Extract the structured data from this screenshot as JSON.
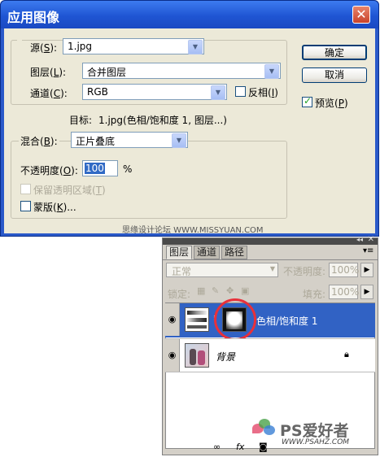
{
  "dialog": {
    "title": "应用图像",
    "close_glyph": "✕",
    "source": {
      "label_pre": "源(",
      "key": "S",
      "label_post": "):",
      "value": "1.jpg"
    },
    "layer": {
      "label_pre": "图层(",
      "key": "L",
      "label_post": "):",
      "value": "合并图层"
    },
    "channel": {
      "label_pre": "通道(",
      "key": "C",
      "label_post": "):",
      "value": "RGB"
    },
    "invert": {
      "label_pre": "反相(",
      "key": "I",
      "label_post": ")",
      "checked": false
    },
    "target": {
      "label": "目标:",
      "value": "1.jpg(色相/饱和度 1, 图层...)"
    },
    "blending": {
      "label_pre": "混合(",
      "key": "B",
      "label_post": "):",
      "value": "正片叠底"
    },
    "opacity": {
      "label_pre": "不透明度(",
      "key": "O",
      "label_post": "):",
      "value": "100",
      "unit": "%"
    },
    "preserve": {
      "label_pre": "保留透明区域(",
      "key": "T",
      "label_post": ")",
      "enabled": false
    },
    "mask": {
      "label_pre": "蒙版(",
      "key": "K",
      "label_post": ")...",
      "checked": false
    },
    "ok_label": "确定",
    "cancel_label": "取消",
    "preview": {
      "label_pre": "预览(",
      "key": "P",
      "label_post": ")",
      "checked": true
    }
  },
  "watermark_top": "思缘设计论坛 WWW.MISSYUAN.COM",
  "panel": {
    "tabs": [
      "图层",
      "通道",
      "路径"
    ],
    "blend_mode": "正常",
    "opacity_label": "不透明度:",
    "opacity_value": "100%",
    "lock_label": "锁定:",
    "fill_label": "填充:",
    "fill_value": "100%",
    "layers": [
      {
        "name": "色相/饱和度 1",
        "selected": true
      },
      {
        "name": "背景",
        "selected": false
      }
    ],
    "footer_icons": [
      "link-icon",
      "fx-icon",
      "mask-icon",
      "adjustment-icon",
      "new-layer-icon"
    ]
  },
  "watermark_bottom": {
    "brand": "PS爱好者",
    "url": "WWW.PSAHZ.COM"
  },
  "colors": {
    "title_bar": "#1f55d3",
    "selected_layer": "#3162c4",
    "highlight_circle": "#e8303a"
  }
}
